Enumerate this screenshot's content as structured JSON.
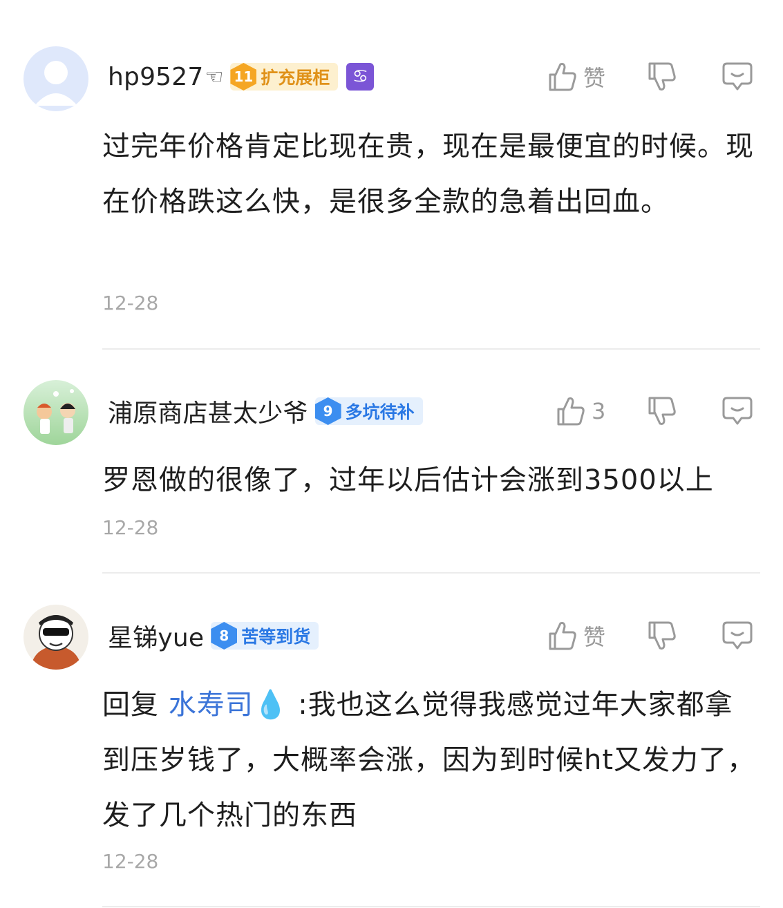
{
  "comments": [
    {
      "username": "hp9527",
      "username_suffix": "☜",
      "badge_level": "11",
      "badge_text": "扩充展柜",
      "zodiac_icon": "cancer-icon",
      "like_label": "赞",
      "text": "过完年价格肯定比现在贵，现在是最便宜的时候。现在价格跌这么快，是很多全款的急着出回血。",
      "date": "12-28"
    },
    {
      "username": "浦原商店甚太少爷",
      "badge_level": "9",
      "badge_text": "多坑待补",
      "like_count": "3",
      "text": "罗恩做的很像了，过年以后估计会涨到3500以上",
      "date": "12-28"
    },
    {
      "username": "星锑yue",
      "badge_level": "8",
      "badge_text": "苦等到货",
      "like_label": "赞",
      "reply_prefix": "回复",
      "reply_target": "水寿司",
      "reply_target_icon": "💧",
      "text": ":我也这么觉得我感觉过年大家都拿到压岁钱了，大概率会涨，因为到时候ht又发力了，发了几个热门的东西",
      "date": "12-28"
    }
  ],
  "colors": {
    "badge_gold": "#f5a623",
    "badge_blue": "#3c8ef0",
    "reply_link": "#3b74d8",
    "date_gray": "#a8a8a8"
  }
}
